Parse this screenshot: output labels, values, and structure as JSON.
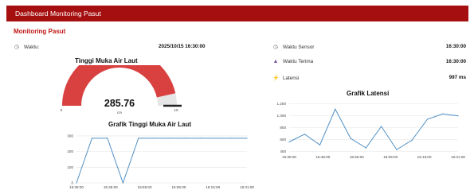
{
  "header": {
    "title": "Dashboard Monitoring Pasut"
  },
  "page": {
    "subtitle": "Monitoring Pasut"
  },
  "left": {
    "time_label": "Waktu:",
    "time_value": "2025/10/15 16:30:00",
    "gauge": {
      "title": "Tinggi Muka Air Laut",
      "value": "285.76",
      "unit": "cm",
      "min_label": "0",
      "max_label": "10",
      "fill_fraction": 0.93
    }
  },
  "right": {
    "sensor_label": "Waktu Sensor",
    "sensor_value": "16:30:00",
    "received_label": "Waktu Terima",
    "received_value": "16:30:00",
    "latency_label": "Latensi",
    "latency_value": "997 ms"
  },
  "icons": {
    "time": "clock-icon",
    "sensor": "clock-icon",
    "received": "user-icon",
    "latency": "lightning-icon"
  },
  "colors": {
    "accent": "#a50f0f",
    "gauge": "#d94040",
    "line": "#4f8fc4"
  },
  "chart_data": [
    {
      "type": "line",
      "title": "Grafik Tinggi Muka Air Laut",
      "x": [
        "15:35:00",
        "15:40:00",
        "15:45:00",
        "15:50:00",
        "15:55:00",
        "16:00:00",
        "16:05:00",
        "16:10:00",
        "16:15:00",
        "16:20:00",
        "16:25:00",
        "16:30:00"
      ],
      "tick_labels": [
        "15:35:00",
        "15:45:00",
        "15:55:00",
        "16:05:00",
        "16:15:09",
        "16:31:00"
      ],
      "values": [
        0,
        285,
        285,
        0,
        285,
        285,
        285,
        285,
        285,
        285,
        285,
        285
      ],
      "y_ticks": [
        "0",
        "100",
        "200",
        "300"
      ],
      "ylim": [
        0,
        320
      ],
      "grid": true
    },
    {
      "type": "line",
      "title": "Grafik Latensi",
      "x": [
        "15:35:00",
        "15:40:00",
        "15:45:00",
        "15:50:00",
        "15:55:00",
        "16:00:00",
        "16:05:00",
        "16:10:00",
        "16:15:00",
        "16:20:00",
        "16:25:00",
        "16:30:00"
      ],
      "tick_labels": [
        "15:35:00",
        "15:45:00",
        "15:55:00",
        "16:05:00",
        "16:15:00",
        "16:31:00"
      ],
      "values": [
        560,
        690,
        510,
        1110,
        620,
        460,
        820,
        430,
        590,
        940,
        1030,
        997
      ],
      "y_ticks": [
        "400",
        "600",
        "800",
        "1.000",
        "1.200"
      ],
      "ylim": [
        380,
        1220
      ],
      "grid": true
    }
  ]
}
